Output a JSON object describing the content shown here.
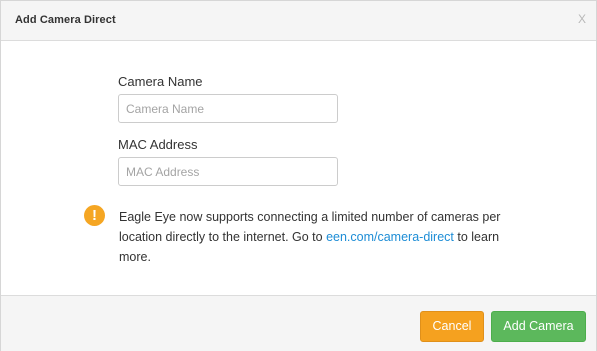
{
  "dialog": {
    "title": "Add Camera Direct",
    "close_label": "X"
  },
  "form": {
    "camera_name": {
      "label": "Camera Name",
      "placeholder": "Camera Name",
      "value": ""
    },
    "mac_address": {
      "label": "MAC Address",
      "placeholder": "MAC Address",
      "value": ""
    }
  },
  "notice": {
    "icon": "warning-icon",
    "icon_glyph": "!",
    "text_before": "Eagle Eye now supports connecting a limited number of cameras per location directly to the internet. Go to ",
    "link_text": "een.com/camera-direct",
    "text_after": " to learn more."
  },
  "footer": {
    "cancel_label": "Cancel",
    "add_label": "Add Camera"
  },
  "colors": {
    "warning": "#f5a623",
    "link": "#1d8dd6",
    "cancel": "#f5a11f",
    "add": "#5cb85c"
  }
}
